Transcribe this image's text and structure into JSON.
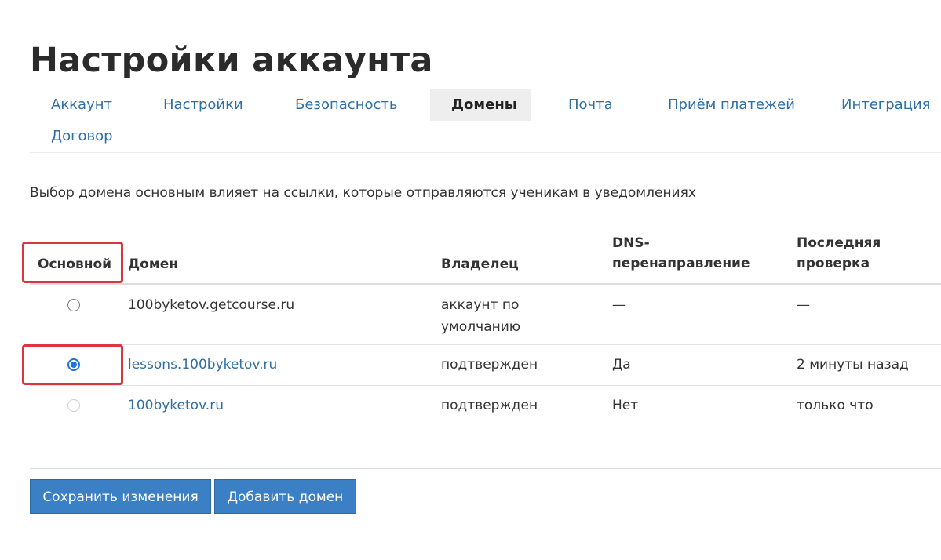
{
  "page": {
    "title": "Настройки аккаунта"
  },
  "tabs": [
    {
      "label": "Аккаунт",
      "active": false
    },
    {
      "label": "Настройки",
      "active": false
    },
    {
      "label": "Безопасность",
      "active": false
    },
    {
      "label": "Домены",
      "active": true
    },
    {
      "label": "Почта",
      "active": false
    },
    {
      "label": "Приём платежей",
      "active": false
    },
    {
      "label": "Интеграция",
      "active": false
    },
    {
      "label": "Договор",
      "active": false
    }
  ],
  "description": "Выбор домена основным влияет на ссылки, которые отправляются ученикам в уведомлениях",
  "table": {
    "headers": {
      "primary": "Основной",
      "domain": "Домен",
      "owner": "Владелец",
      "dns_line1": "DNS-",
      "dns_line2": "перенаправление",
      "check_line1": "Последняя",
      "check_line2": "проверка"
    },
    "rows": [
      {
        "selected": false,
        "disabled": false,
        "domain": "100byketov.getcourse.ru",
        "owner_line1": "аккаунт по",
        "owner_line2": "умолчанию",
        "dns": "—",
        "last_check": "—"
      },
      {
        "selected": true,
        "disabled": false,
        "domain": "lessons.100byketov.ru",
        "owner_line1": "подтвержден",
        "dns": "Да",
        "last_check": "2 минуты назад"
      },
      {
        "selected": false,
        "disabled": true,
        "domain": "100byketov.ru",
        "owner_line1": "подтвержден",
        "dns": "Нет",
        "last_check": "только что"
      }
    ]
  },
  "buttons": {
    "save": "Сохранить изменения",
    "add_domain": "Добавить домен"
  },
  "colors": {
    "link": "#2f6fa3",
    "button": "#3b7fc4",
    "highlight": "#d9363e",
    "radio_checked": "#1a73e8"
  }
}
